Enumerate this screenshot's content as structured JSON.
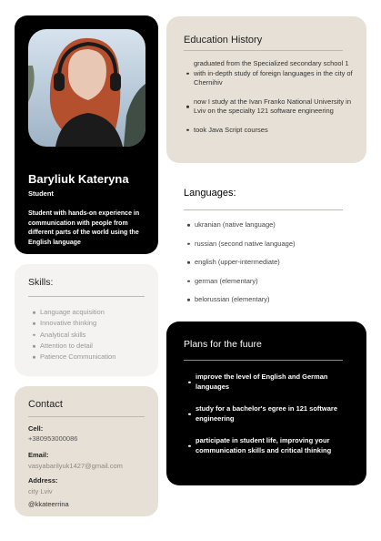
{
  "profile": {
    "name": "Baryliuk Kateryna",
    "role": "Student",
    "bio": "Student with hands-on experience in communication with people from different parts of the world using the English language"
  },
  "skills": {
    "title": "Skills:",
    "items": [
      "Language acquisition",
      "Innovative thinking",
      "Analytical skills",
      "Attention to detail",
      "Patience Communication"
    ]
  },
  "contact": {
    "title": "Contact",
    "cell_label": "Cell:",
    "cell_value": "+380953000086",
    "email_label": "Email:",
    "email_value": "vasyabarilyuk1427@gmail.com",
    "address_label": "Address:",
    "address_value": "city Lviv",
    "handle": "@kkateerrina"
  },
  "education": {
    "title": "Education History",
    "items": [
      "graduated from the Specialized secondary school 1 with in-depth study of foreign languages in the city of Chernihiv",
      "now I study at the Ivan Franko National University in Lviv on the specialty 121 software engineering",
      "took Java Script courses"
    ]
  },
  "languages": {
    "title": "Languages:",
    "items": [
      "ukranian (native language)",
      "russian (second native language)",
      "english (upper-intermediate)",
      "german (elementary)",
      "belorussian (elementary)"
    ]
  },
  "plans": {
    "title": "Plans for the fuure",
    "items": [
      "improve the level of English and German languages",
      "study for a bachelor's egree in 121 software engineering",
      "participate in student life, improving your communication skills and critical thinking"
    ]
  },
  "colors": {
    "dark_card": "#000000",
    "beige_card": "#e6e0d6",
    "light_card": "#f4f3f1"
  }
}
